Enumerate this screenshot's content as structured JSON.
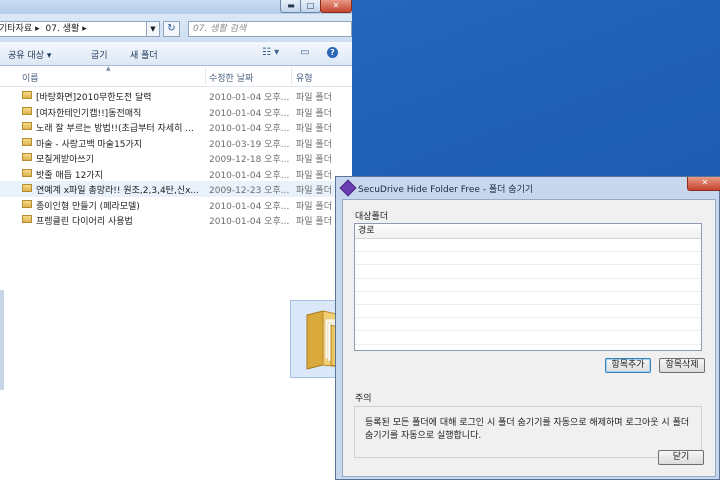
{
  "explorer": {
    "breadcrumb": [
      "기타자료",
      "07. 생활"
    ],
    "search_placeholder": "07. 생활 검색",
    "toolbar": {
      "share": "공유 대상 ▾",
      "burn": "굽기",
      "new_folder": "새 폴더"
    },
    "columns": {
      "name": "이름",
      "date": "수정한 날짜",
      "type": "유형"
    },
    "files": [
      {
        "name": "[바탕화면]2010무한도전 달력",
        "date": "2010-01-04 오후...",
        "type": "파일 폴더"
      },
      {
        "name": "[여자한테인기캡!!]동전매직",
        "date": "2010-01-04 오후...",
        "type": "파일 폴더"
      },
      {
        "name": "노래 잘 부르는 방법!!(초급부터 자세히 ...",
        "date": "2010-01-04 오후...",
        "type": "파일 폴더"
      },
      {
        "name": "마술 - 사랑고백 마술15가지",
        "date": "2010-03-19 오후...",
        "type": "파일 폴더"
      },
      {
        "name": "모칠게받아쓰기",
        "date": "2009-12-18 오후...",
        "type": "파일 폴더"
      },
      {
        "name": "밧줄 매듭 12가지",
        "date": "2010-01-04 오후...",
        "type": "파일 폴더"
      },
      {
        "name": "연예계 x파일 총망라!! 원조,2,3,4탄,신x...",
        "date": "2009-12-23 오후...",
        "type": "파일 폴더"
      },
      {
        "name": "종이인형 만들기 (페라모델)",
        "date": "2010-01-04 오후...",
        "type": "파일 폴더"
      },
      {
        "name": "프렝클린 다이어리 사용법",
        "date": "2010-01-04 오후...",
        "type": "파일 폴더"
      }
    ],
    "selected_index": 6
  },
  "dialog": {
    "title": "SecuDrive Hide Folder Free - 폴더 숨기기",
    "target_folder_label": "대상폴더",
    "list_header": "경로",
    "add_button": "항목추가",
    "delete_button": "항목삭제",
    "notice_label": "주의",
    "notice_text": "등록된 모든 폴더에 대해 로그인 시 폴더 숨기기를 자동으로 해제하며 로그아웃 시 폴더 숨기기를 자동으로 실행합니다.",
    "close_button": "닫기"
  }
}
